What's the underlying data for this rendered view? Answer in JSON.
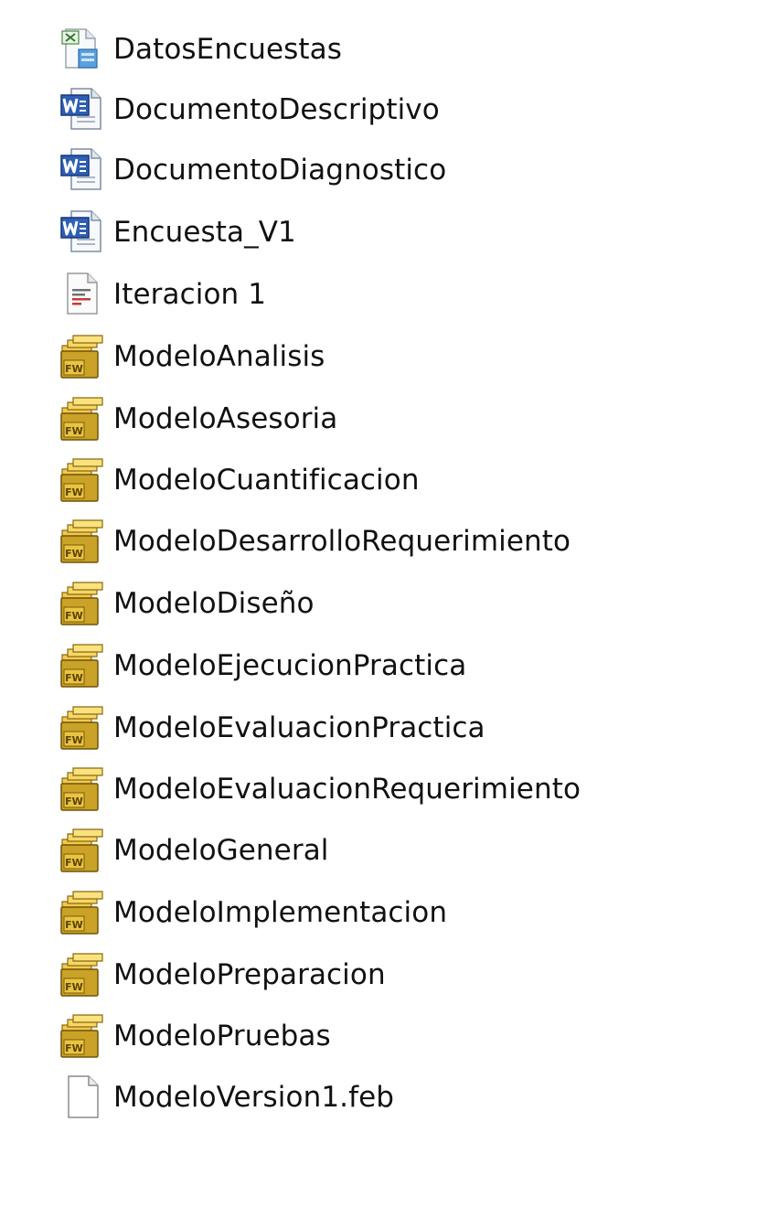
{
  "files": [
    {
      "name": "DatosEncuestas",
      "icon": "spreadsheet-file-icon",
      "kind": "xls"
    },
    {
      "name": "DocumentoDescriptivo",
      "icon": "word-document-icon",
      "kind": "word"
    },
    {
      "name": "DocumentoDiagnostico",
      "icon": "word-document-icon",
      "kind": "word"
    },
    {
      "name": "Encuesta_V1",
      "icon": "word-document-icon",
      "kind": "word"
    },
    {
      "name": "Iteracion 1",
      "icon": "pdf-document-icon",
      "kind": "pdf"
    },
    {
      "name": "ModeloAnalisis",
      "icon": "fireworks-file-icon",
      "kind": "fw"
    },
    {
      "name": "ModeloAsesoria",
      "icon": "fireworks-file-icon",
      "kind": "fw"
    },
    {
      "name": "ModeloCuantificacion",
      "icon": "fireworks-file-icon",
      "kind": "fw"
    },
    {
      "name": "ModeloDesarrolloRequerimiento",
      "icon": "fireworks-file-icon",
      "kind": "fw"
    },
    {
      "name": "ModeloDiseño",
      "icon": "fireworks-file-icon",
      "kind": "fw"
    },
    {
      "name": "ModeloEjecucionPractica",
      "icon": "fireworks-file-icon",
      "kind": "fw"
    },
    {
      "name": "ModeloEvaluacionPractica",
      "icon": "fireworks-file-icon",
      "kind": "fw"
    },
    {
      "name": "ModeloEvaluacionRequerimiento",
      "icon": "fireworks-file-icon",
      "kind": "fw"
    },
    {
      "name": "ModeloGeneral",
      "icon": "fireworks-file-icon",
      "kind": "fw"
    },
    {
      "name": "ModeloImplementacion",
      "icon": "fireworks-file-icon",
      "kind": "fw"
    },
    {
      "name": "ModeloPreparacion",
      "icon": "fireworks-file-icon",
      "kind": "fw"
    },
    {
      "name": "ModeloPruebas",
      "icon": "fireworks-file-icon",
      "kind": "fw"
    },
    {
      "name": "ModeloVersion1.feb",
      "icon": "generic-file-icon",
      "kind": "blank"
    }
  ]
}
